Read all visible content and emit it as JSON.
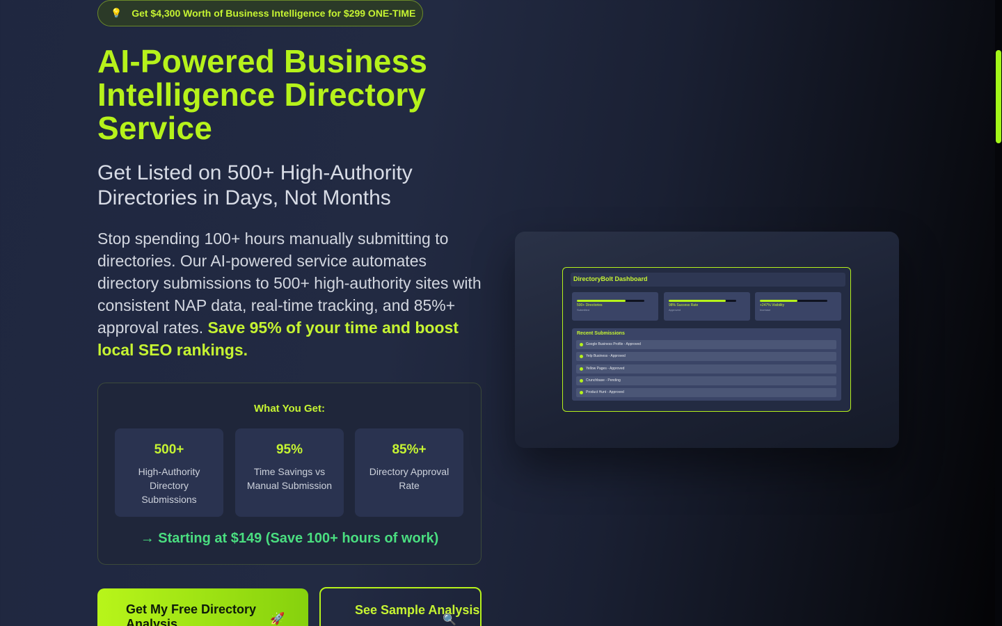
{
  "promo": {
    "icon": "lightbulb-icon",
    "text": "Get $4,300 Worth of Business Intelligence for $299 ONE-TIME"
  },
  "hero": {
    "title_lines": [
      "AI-Powered Business",
      "Intelligence Directory",
      "Service"
    ],
    "subtitle_lines": [
      "Get Listed on 500+ High-Authority",
      "Directories in Days, Not Months"
    ],
    "description": "Stop spending 100+ hours manually submitting to directories. Our AI-powered service automates directory submissions to 500+ high-authority sites with consistent NAP data, real-time tracking, and 85%+ approval rates. ",
    "description_highlight": "Save 95% of your time and boost local SEO rankings."
  },
  "what_you_get": {
    "title": "What You Get:",
    "stats": [
      {
        "value": "500+",
        "label": "High-Authority Directory Submissions"
      },
      {
        "value": "95%",
        "label": "Time Savings vs Manual Submission"
      },
      {
        "value": "85%+",
        "label": "Directory Approval Rate"
      }
    ],
    "starting": "→ Starting at $149 (Save 100+ hours of work)"
  },
  "cta": {
    "primary_label": "Get My Free Directory Analysis",
    "primary_icon": "rocket-icon",
    "secondary_label": "See Sample Analysis",
    "secondary_icon": "magnifier-icon"
  },
  "dashboard": {
    "title": "DirectoryBolt Dashboard",
    "metrics": [
      {
        "label": "500+ Directories",
        "sub": "Submitted",
        "level": 0.72
      },
      {
        "label": "98% Success Rate",
        "sub": "Approved",
        "level": 0.85
      },
      {
        "label": "+247% Visibility",
        "sub": "Increase",
        "level": 0.56
      }
    ],
    "recent_title": "Recent Submissions",
    "submissions": [
      "Google Business Profile - Approved",
      "Yelp Business - Approved",
      "Yellow Pages - Approved",
      "Crunchbase - Pending",
      "Product Hunt - Approved"
    ]
  },
  "colors": {
    "accent": "#b6f21b",
    "success": "#4ade80",
    "background": "#1f2740"
  }
}
